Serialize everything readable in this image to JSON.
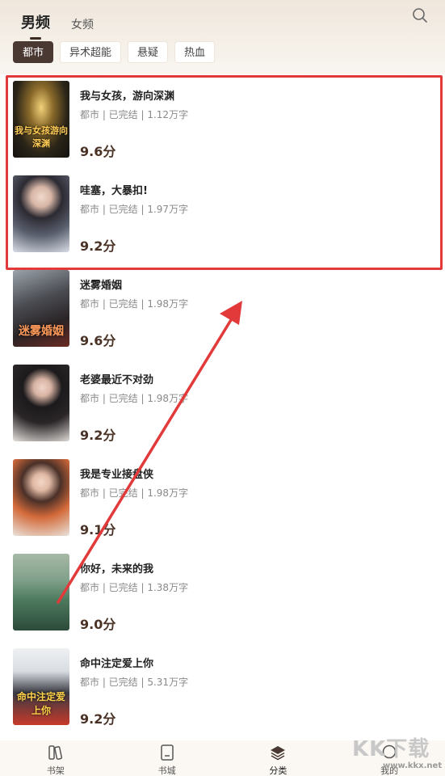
{
  "header": {
    "gender_tabs": [
      {
        "label": "男频",
        "active": true
      },
      {
        "label": "女频",
        "active": false
      }
    ],
    "search_icon": "search-icon"
  },
  "categories": [
    {
      "label": "都市",
      "active": true
    },
    {
      "label": "异术超能",
      "active": false
    },
    {
      "label": "悬疑",
      "active": false
    },
    {
      "label": "热血",
      "active": false
    }
  ],
  "books": [
    {
      "title": "我与女孩，游向深渊",
      "meta": "都市 | 已完结 | 1.12万字",
      "score": "9.6分",
      "cover_text": "我与女孩游向深渊"
    },
    {
      "title": "哇塞，大暴扣!",
      "meta": "都市 | 已完结 | 1.97万字",
      "score": "9.2分",
      "cover_text": ""
    },
    {
      "title": "迷雾婚姻",
      "meta": "都市 | 已完结 | 1.98万字",
      "score": "9.6分",
      "cover_text": "迷雾婚姻"
    },
    {
      "title": "老婆最近不对劲",
      "meta": "都市 | 已完结 | 1.98万字",
      "score": "9.2分",
      "cover_text": ""
    },
    {
      "title": "我是专业接盘侠",
      "meta": "都市 | 已完结 | 1.98万字",
      "score": "9.1分",
      "cover_text": ""
    },
    {
      "title": "你好，未来的我",
      "meta": "都市 | 已完结 | 1.38万字",
      "score": "9.0分",
      "cover_text": ""
    },
    {
      "title": "命中注定爱上你",
      "meta": "都市 | 已完结 | 5.31万字",
      "score": "9.2分",
      "cover_text": "命中注定爱上你"
    }
  ],
  "bottom_nav": [
    {
      "label": "书架",
      "icon": "bookshelf-icon"
    },
    {
      "label": "书城",
      "icon": "book-icon"
    },
    {
      "label": "分类",
      "icon": "layers-icon"
    },
    {
      "label": "我的",
      "icon": "profile-icon"
    }
  ],
  "watermark": {
    "text": "KK下载",
    "sub": "www.kkx.net"
  },
  "colors": {
    "accent": "#4a3833",
    "highlight": "#e23a3a",
    "score": "#4a3226"
  }
}
